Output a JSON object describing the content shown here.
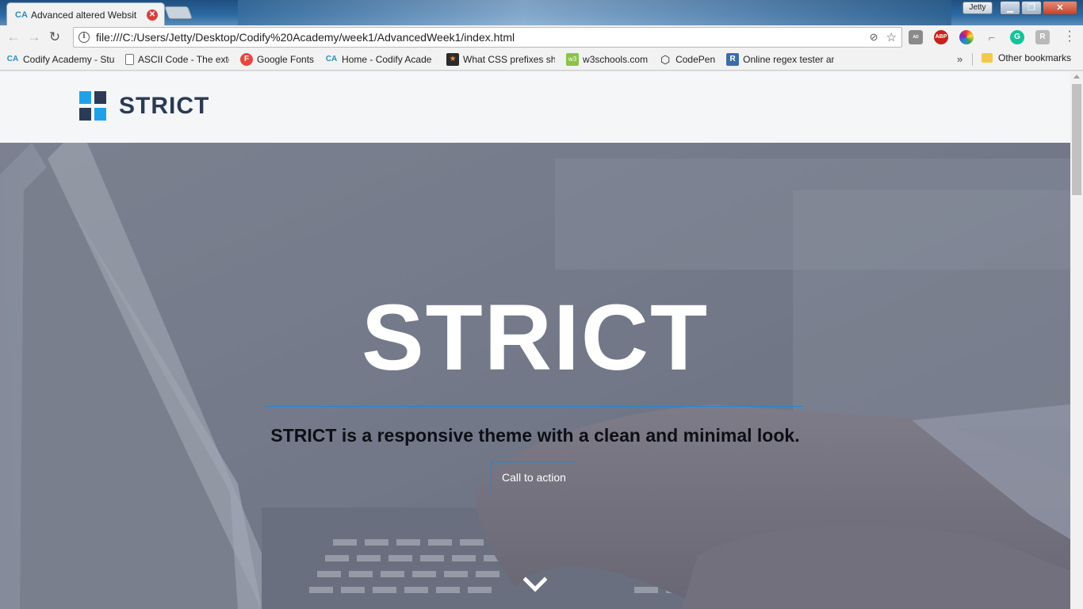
{
  "browser": {
    "tab": {
      "favicon": "CA",
      "title": "Advanced altered Websit"
    },
    "user_badge": "Jetty",
    "address": {
      "url": "file:///C:/Users/Jetty/Desktop/Codify%20Academy/week1/AdvancedWeek1/index.html"
    },
    "bookmarks": [
      {
        "icon": "CA",
        "label": "Codify Academy - Stu"
      },
      {
        "icon": "doc",
        "label": "ASCII Code - The exte"
      },
      {
        "icon": "F",
        "label": "Google Fonts"
      },
      {
        "icon": "CA",
        "label": "Home - Codify Acade"
      },
      {
        "icon": "star",
        "label": "What CSS prefixes sho"
      },
      {
        "icon": "w3",
        "label": "w3schools.com"
      },
      {
        "icon": "codepen",
        "label": "CodePen"
      },
      {
        "icon": "R",
        "label": "Online regex tester an"
      }
    ],
    "bookmarks_more": "»",
    "other_bookmarks": "Other bookmarks",
    "extensions": [
      "AD ADS",
      "ABP",
      "color-wheel",
      "ruler",
      "G",
      "R"
    ]
  },
  "site": {
    "logo_text": "STRICT",
    "hero": {
      "title": "STRICT",
      "subtitle": "STRICT is a responsive theme with a clean and minimal look.",
      "cta_label": "Call to action"
    },
    "colors": {
      "accent": "#1fa1e8",
      "navy": "#2b3a55",
      "rule": "#1f86d8"
    }
  }
}
